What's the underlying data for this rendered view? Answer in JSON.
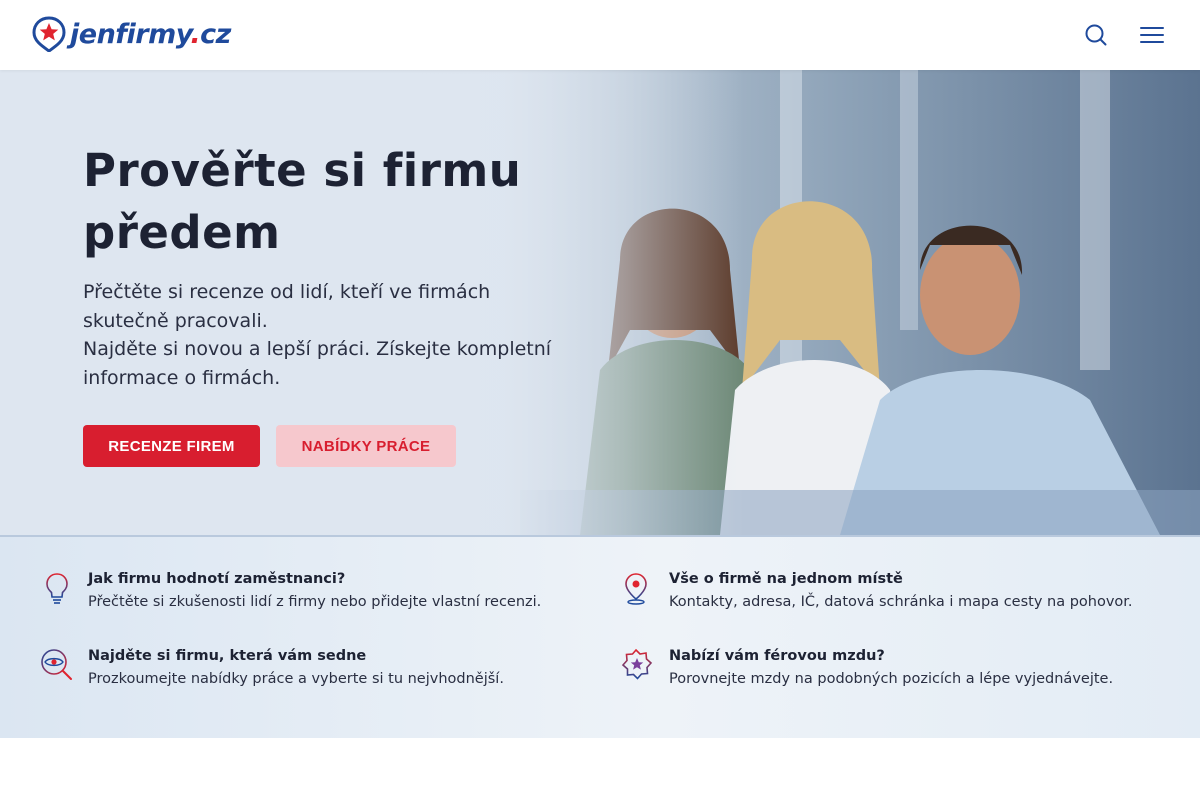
{
  "header": {
    "logo": {
      "main": "jenfirmy",
      "dot": ".",
      "tld": "cz"
    },
    "icons": [
      "search-icon",
      "hamburger-menu-icon"
    ]
  },
  "hero": {
    "title": "Prověřte si firmu předem",
    "subtitle_line1": "Přečtěte si recenze od lidí, kteří ve firmách skutečně pracovali.",
    "subtitle_line2": "Najděte si novou a lepší práci. Získejte kompletní informace o firmách.",
    "primary_button": "RECENZE FIREM",
    "secondary_button": "NABÍDKY PRÁCE"
  },
  "features": [
    {
      "icon": "lightbulb-icon",
      "title": "Jak firmu hodnotí zaměstnanci?",
      "description": "Přečtěte si zkušenosti lidí z firmy nebo přidejte vlastní recenzi."
    },
    {
      "icon": "map-pin-icon",
      "title": "Vše o firmě na jednom místě",
      "description": "Kontakty, adresa, IČ, datová schránka i mapa cesty na pohovor."
    },
    {
      "icon": "search-eye-icon",
      "title": "Najděte si firmu, která vám sedne",
      "description": "Prozkoumejte nabídky práce a vyberte si tu nejvhodnější."
    },
    {
      "icon": "star-badge-icon",
      "title": "Nabízí vám férovou mzdu?",
      "description": "Porovnejte mzdy na podobných pozicích a lépe vyjednávejte."
    }
  ],
  "colors": {
    "brand_blue": "#1f4a9c",
    "brand_red": "#d81e2f",
    "button_secondary_bg": "#f6c8cd"
  }
}
